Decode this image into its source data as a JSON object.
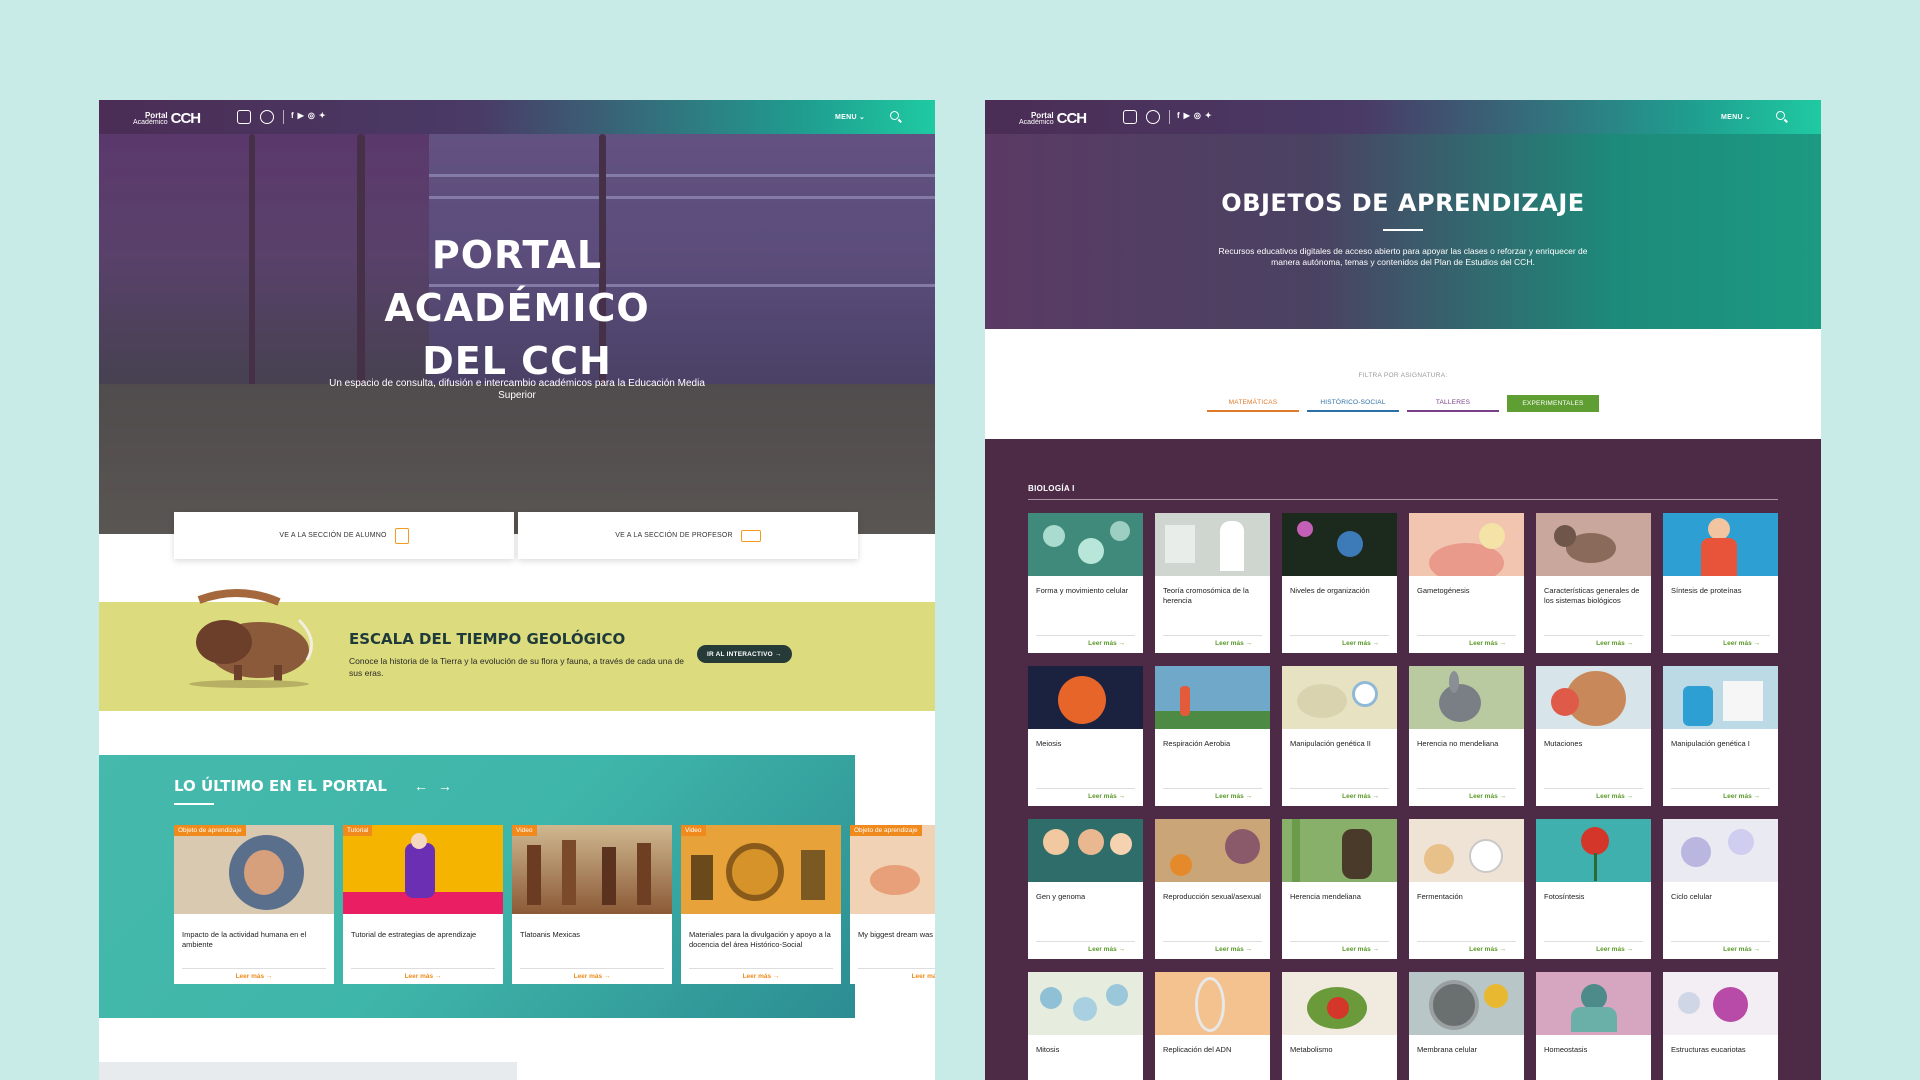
{
  "nav": {
    "logo_small": "Portal",
    "logo_sub": "Académico",
    "logo_mark": "CCH",
    "social_icons": [
      "facebook-icon",
      "youtube-icon",
      "instagram-icon",
      "twitter-icon"
    ],
    "menu_label": "MENU ⌄"
  },
  "home": {
    "hero_title": "PORTAL\nACADÉMICO\nDEL CCH",
    "hero_subtitle": "Un espacio de consulta, difusión e intercambio académicos para la Educación Media Superior",
    "btn_alumno": "VE A LA SECCIÓN DE ALUMNO",
    "btn_profesor": "VE A LA SECCIÓN DE PROFESOR",
    "band_title": "ESCALA DEL TIEMPO GEOLÓGICO",
    "band_text": "Conoce la historia de la Tierra y la evolución de su flora y fauna, a través de cada una de sus eras.",
    "band_button": "IR AL INTERACTIVO →",
    "latest_title": "LO ÚLTIMO EN EL PORTAL",
    "latest_arrows": "← →",
    "read_more": "Leer más →",
    "cards": [
      {
        "tag": "Objeto de aprendizaje",
        "title": "Impacto de la actividad humana en el ambiente",
        "color": "#d8c9b0"
      },
      {
        "tag": "Tutorial",
        "title": "Tutorial de estrategias de aprendizaje",
        "color": "#f4b400"
      },
      {
        "tag": "Video",
        "title": "Tlatoanis Mexicas",
        "color": "#a8845a"
      },
      {
        "tag": "Video",
        "title": "Materiales para la divulgación y apoyo a la docencia del área Histórico-Social",
        "color": "#e7a33a"
      },
      {
        "tag": "Objeto de aprendizaje",
        "title": "My biggest dream was",
        "color": "#f2d2b4"
      }
    ]
  },
  "objetos": {
    "hero_title": "OBJETOS DE APRENDIZAJE",
    "hero_subtitle": "Recursos educativos digitales de acceso abierto para apoyar las clases o reforzar y enriquecer de manera autónoma, temas y contenidos del Plan de Estudios del CCH.",
    "filter_label": "FILTRA POR ASIGNATURA:",
    "filters": [
      {
        "label": "MATEMÁTICAS",
        "color": "#e07a2a",
        "active": false
      },
      {
        "label": "HISTÓRICO-SOCIAL",
        "color": "#2a6fa5",
        "active": false
      },
      {
        "label": "TALLERES",
        "color": "#7a3f8a",
        "active": false
      },
      {
        "label": "EXPERIMENTALES",
        "color": "#5f9e32",
        "active": true
      }
    ],
    "section_title": "BIOLOGÍA I",
    "read_more": "Leer más →",
    "items": [
      {
        "title": "Forma y movimiento celular",
        "color": "#3f8a7a"
      },
      {
        "title": "Teoría cromosómica de la herencia",
        "color": "#cfd6d0"
      },
      {
        "title": "Niveles de organización",
        "color": "#1c2a1e"
      },
      {
        "title": "Gametogénesis",
        "color": "#f2c5b0"
      },
      {
        "title": "Características generales de los sistemas biológicos",
        "color": "#c9a79d"
      },
      {
        "title": "Síntesis de proteínas",
        "color": "#2e9fd2"
      },
      {
        "title": "Meiosis",
        "color": "#1a2240"
      },
      {
        "title": "Respiración Aerobia",
        "color": "#6fa8c8"
      },
      {
        "title": "Manipulación genética II",
        "color": "#e7e3c2"
      },
      {
        "title": "Herencia no mendeliana",
        "color": "#b9c9a0"
      },
      {
        "title": "Mutaciones",
        "color": "#d7e4ea"
      },
      {
        "title": "Manipulación genética I",
        "color": "#bcd9e6"
      },
      {
        "title": "Gen y genoma",
        "color": "#2f6d6a"
      },
      {
        "title": "Reproducción sexual/asexual",
        "color": "#c9a577"
      },
      {
        "title": "Herencia mendeliana",
        "color": "#89b06a"
      },
      {
        "title": "Fermentación",
        "color": "#efe3d6"
      },
      {
        "title": "Fotosíntesis",
        "color": "#3fb0ad"
      },
      {
        "title": "Ciclo celular",
        "color": "#eaeaf3"
      },
      {
        "title": "Mitosis",
        "color": "#e7edde"
      },
      {
        "title": "Replicación del ADN",
        "color": "#f3c28f"
      },
      {
        "title": "Metabolismo",
        "color": "#f0eadf"
      },
      {
        "title": "Membrana celular",
        "color": "#b9c6c8"
      },
      {
        "title": "Homeostasis",
        "color": "#d6a6c0"
      },
      {
        "title": "Estructuras eucariotas",
        "color": "#f3eef3"
      }
    ]
  }
}
